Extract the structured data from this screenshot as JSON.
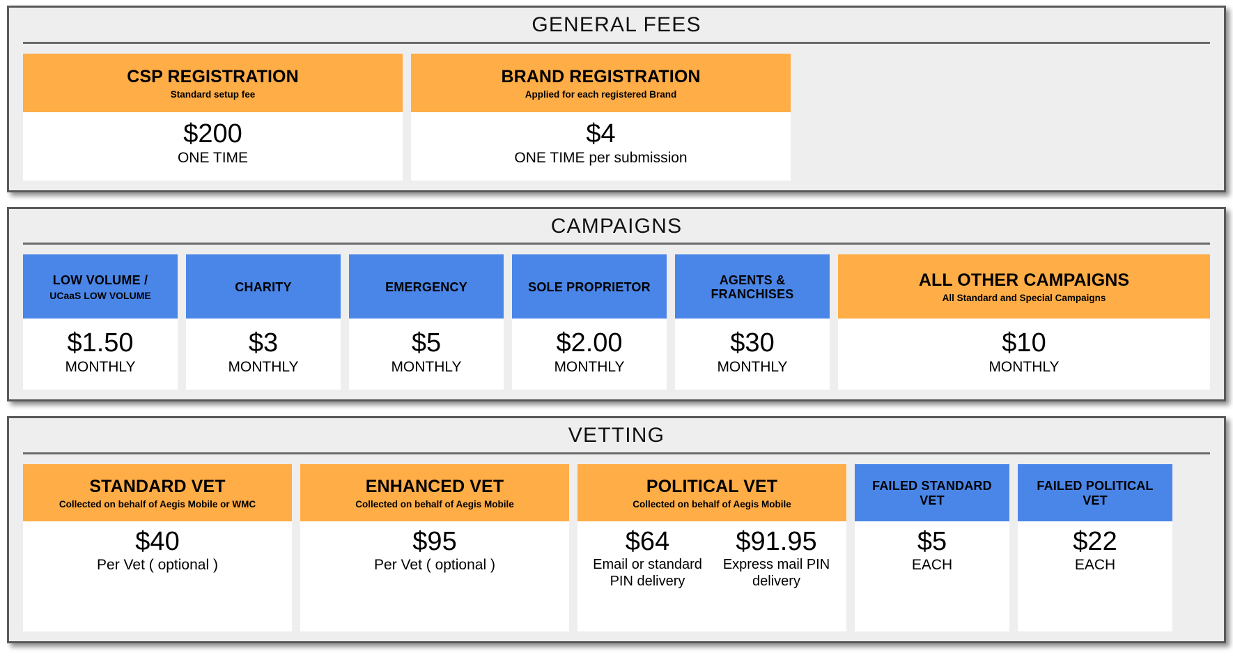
{
  "sections": [
    {
      "id": "general-fees",
      "title": "GENERAL FEES",
      "cards": [
        {
          "name": "csp-registration",
          "head_color": "orange",
          "title": "CSP REGISTRATION",
          "subtitle": "Standard setup fee",
          "price": "$200",
          "note": "ONE TIME"
        },
        {
          "name": "brand-registration",
          "head_color": "orange",
          "title": "BRAND REGISTRATION",
          "subtitle": "Applied for each registered Brand",
          "price": "$4",
          "note": "ONE TIME per submission"
        }
      ]
    },
    {
      "id": "campaigns",
      "title": "CAMPAIGNS",
      "cards": [
        {
          "name": "low-volume",
          "head_color": "blue",
          "title": "LOW VOLUME /",
          "subtitle": "UCaaS LOW VOLUME",
          "price": "$1.50",
          "note": "MONTHLY"
        },
        {
          "name": "charity",
          "head_color": "blue",
          "title": "CHARITY",
          "subtitle": "",
          "price": "$3",
          "note": "MONTHLY"
        },
        {
          "name": "emergency",
          "head_color": "blue",
          "title": "EMERGENCY",
          "subtitle": "",
          "price": "$5",
          "note": "MONTHLY"
        },
        {
          "name": "sole-proprietor",
          "head_color": "blue",
          "title": "SOLE PROPRIETOR",
          "subtitle": "",
          "price": "$2.00",
          "note": "MONTHLY"
        },
        {
          "name": "agents-franchises",
          "head_color": "blue",
          "title": "AGENTS & FRANCHISES",
          "subtitle": "",
          "price": "$30",
          "note": "MONTHLY"
        },
        {
          "name": "all-other-campaigns",
          "head_color": "orange",
          "title": "ALL OTHER CAMPAIGNS",
          "subtitle": "All Standard and Special Campaigns",
          "price": "$10",
          "note": "MONTHLY"
        }
      ]
    },
    {
      "id": "vetting",
      "title": "VETTING",
      "cards": [
        {
          "name": "standard-vet",
          "head_color": "orange",
          "title": "STANDARD VET",
          "subtitle": "Collected on behalf of Aegis Mobile or WMC",
          "price": "$40",
          "note": "Per Vet ( optional )"
        },
        {
          "name": "enhanced-vet",
          "head_color": "orange",
          "title": "ENHANCED VET",
          "subtitle": "Collected on behalf of Aegis Mobile",
          "price": "$95",
          "note": "Per Vet ( optional )"
        },
        {
          "name": "political-vet",
          "head_color": "orange",
          "title": "POLITICAL VET",
          "subtitle": "Collected on behalf of Aegis Mobile",
          "price_a": "$64",
          "note_a": "Email or standard PIN delivery",
          "price_b": "$91.95",
          "note_b": "Express mail PIN delivery"
        },
        {
          "name": "failed-standard-vet",
          "head_color": "blue",
          "title": "FAILED STANDARD VET",
          "subtitle": "",
          "price": "$5",
          "note": "EACH"
        },
        {
          "name": "failed-political-vet",
          "head_color": "blue",
          "title": "FAILED POLITICAL VET",
          "subtitle": "",
          "price": "$22",
          "note": "EACH"
        }
      ]
    }
  ],
  "colors": {
    "orange": "#FFAD47",
    "blue": "#4A86E8",
    "panel_bg": "#EEEEEE",
    "panel_border": "#595959",
    "card_bg": "#FFFFFF"
  }
}
